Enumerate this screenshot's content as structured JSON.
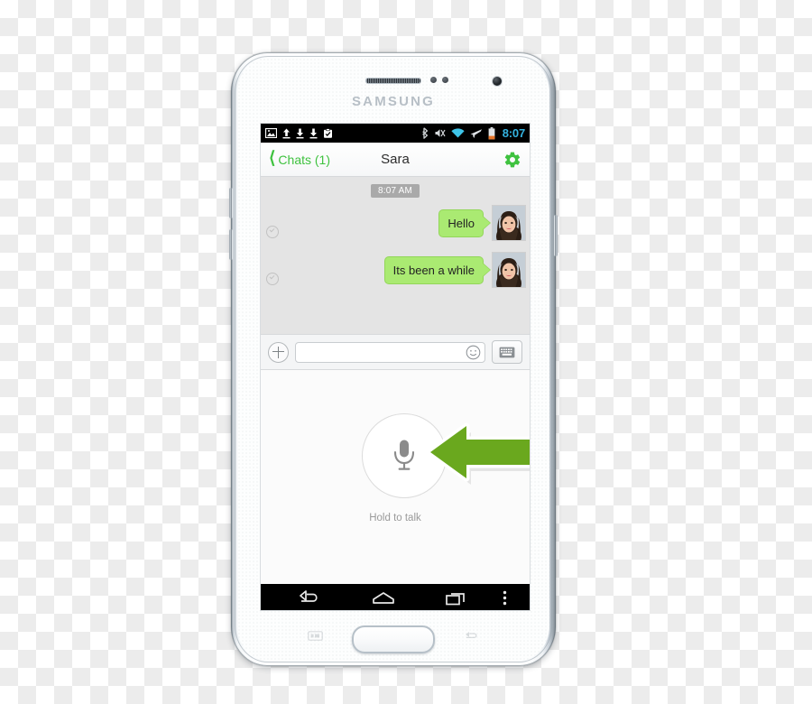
{
  "device": {
    "brand": "SAMSUNG",
    "hardware": {
      "earpiece": "earpiece-speaker",
      "proximity_sensor": "proximity-sensor",
      "light_sensor": "light-sensor",
      "front_camera": "front-camera",
      "home_button": "home-button",
      "volume_up": "volume-up-button",
      "volume_down": "volume-down-button",
      "power": "power-button",
      "capacitive_recent": "recent-apps-key",
      "capacitive_back": "back-key"
    }
  },
  "status_bar": {
    "time": "8:07",
    "time_color": "#34b3e0",
    "left_icons": [
      "image-icon",
      "upload-icon",
      "download-icon",
      "download-icon",
      "app-install-icon"
    ],
    "right_icons": [
      "bluetooth-icon",
      "mute-icon",
      "wifi-icon",
      "airplane-mode-icon",
      "battery-icon"
    ],
    "wifi_color": "#3ec4e8",
    "battery_color": "#e8762a"
  },
  "app_header": {
    "back_label": "Chats (1)",
    "title": "Sara",
    "accent_color": "#3fc23f",
    "settings_icon": "gear-icon"
  },
  "chat": {
    "timestamp": "8:07 AM",
    "background_color": "#e4e4e4",
    "bubble_color": "#aaea72",
    "messages": [
      {
        "text": "Hello",
        "status": "delivered",
        "avatar": "contact-avatar"
      },
      {
        "text": "Its been a while",
        "status": "delivered",
        "avatar": "contact-avatar"
      }
    ]
  },
  "input_bar": {
    "add_icon": "plus-icon",
    "message_value": "",
    "message_placeholder": "",
    "emoji_icon": "smiley-icon",
    "keyboard_icon": "keyboard-icon"
  },
  "voice_panel": {
    "mic_icon": "microphone-icon",
    "hold_label": "Hold to talk",
    "annotation": {
      "type": "arrow",
      "direction": "left",
      "color": "#6aa81e",
      "points_at": "microphone-button"
    }
  },
  "nav_bar": {
    "back": "back-icon",
    "home": "home-icon",
    "recents": "recent-apps-icon",
    "menu": "overflow-menu-icon"
  }
}
